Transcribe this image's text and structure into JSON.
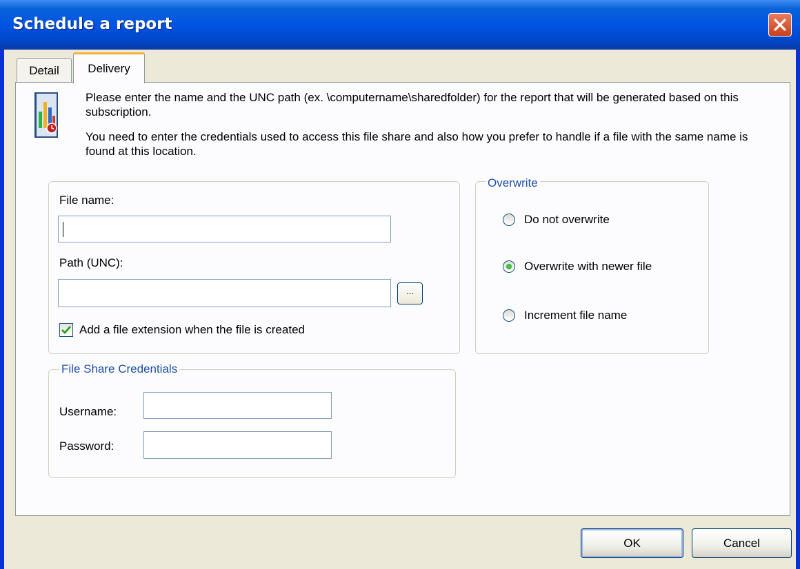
{
  "window": {
    "title": "Schedule a report"
  },
  "tabs": [
    {
      "label": "Detail",
      "active": false
    },
    {
      "label": "Delivery",
      "active": true
    }
  ],
  "intro": {
    "line1": "Please enter the name and the UNC path (ex. \\computername\\sharedfolder) for the report that will be generated based on this subscription.",
    "line2": "You need to enter the credentials used to access this file share and also how you prefer to handle if a file with the same name is found at this location."
  },
  "file_group": {
    "file_name_label": "File name:",
    "file_name_value": "",
    "path_label": "Path (UNC):",
    "path_value": "",
    "browse_label": "...",
    "add_extension_label": "Add a file extension when the file is created",
    "add_extension_checked": true
  },
  "credentials": {
    "legend": "File Share Credentials",
    "username_label": "Username:",
    "username_value": "",
    "password_label": "Password:",
    "password_value": ""
  },
  "overwrite": {
    "legend": "Overwrite",
    "options": [
      {
        "label": "Do not overwrite",
        "selected": false
      },
      {
        "label": "Overwrite with newer file",
        "selected": true
      },
      {
        "label": "Increment file name",
        "selected": false
      }
    ]
  },
  "buttons": {
    "ok": "OK",
    "cancel": "Cancel"
  },
  "colors": {
    "titlebar": "#0054e3",
    "dialog_bg": "#ece9d8",
    "group_legend": "#1f4fa8",
    "radio_selected": "#21a121",
    "active_tab_accent": "#f3b233"
  },
  "icons": {
    "close": "close-x-icon",
    "report": "report-chart-icon",
    "checkmark": "checkmark-icon"
  }
}
